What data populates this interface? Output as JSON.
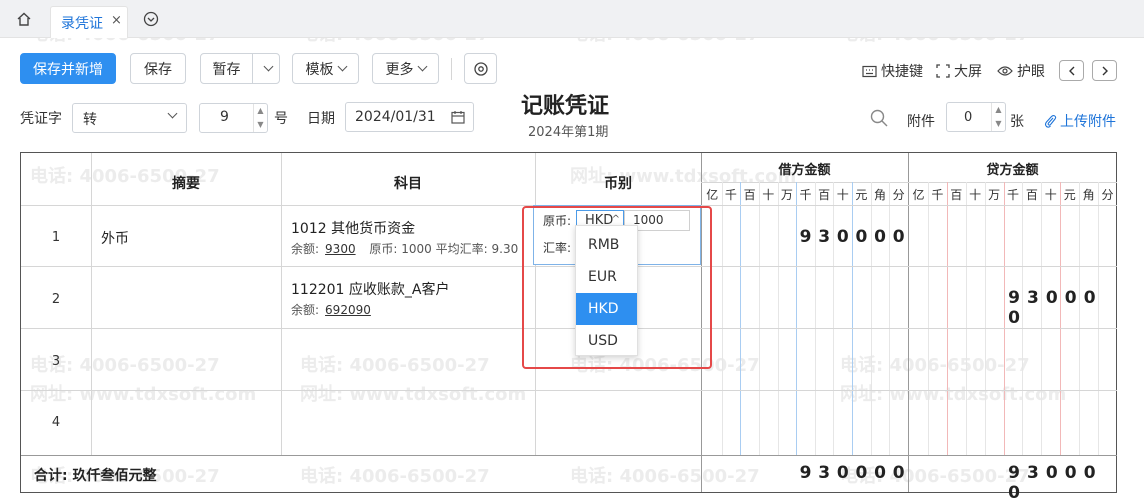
{
  "watermark": {
    "phone": "电话: 4006-6500-27",
    "site": "网址: www.tdxsoft.com"
  },
  "tabs": [
    {
      "label": "录凭证",
      "close": "×"
    }
  ],
  "toolbar": {
    "save_and_new": "保存并新增",
    "save": "保存",
    "draft": "暂存",
    "template": "模板",
    "more": "更多",
    "shortcut": "快捷键",
    "fullscreen": "大屏",
    "eye_care": "护眼"
  },
  "header": {
    "voucher_word_label": "凭证字",
    "voucher_word_value": "转",
    "number_value": "9",
    "number_suffix": "号",
    "date_label": "日期",
    "date_value": "2024/01/31",
    "title": "记账凭证",
    "period": "2024年第1期",
    "attachment_label": "附件",
    "attachment_value": "0",
    "attachment_suffix": "张",
    "upload_label": "上传附件"
  },
  "table": {
    "headers": {
      "summary": "摘要",
      "account": "科目",
      "currency": "币别",
      "debit": "借方金额",
      "credit": "贷方金额"
    },
    "digit_units": [
      "亿",
      "千",
      "百",
      "十",
      "万",
      "千",
      "百",
      "十",
      "元",
      "角",
      "分"
    ],
    "rows": [
      {
        "num": "1",
        "summary": "外币",
        "account": "1012 其他货币资金",
        "balance_label": "余额:",
        "balance": "9300",
        "extra": "原币: 1000 平均汇率: 9.30",
        "debit_digits": [
          "9",
          "3",
          "0",
          "0",
          "0",
          "0"
        ],
        "credit_digits": []
      },
      {
        "num": "2",
        "summary": "",
        "account": "112201 应收账款_A客户",
        "balance_label": "余额:",
        "balance": "692090",
        "extra": "",
        "debit_digits": [],
        "credit_digits": [
          "9",
          "3",
          "0",
          "0",
          "0",
          "0"
        ]
      },
      {
        "num": "3",
        "summary": "",
        "account": "",
        "balance_label": "",
        "balance": "",
        "extra": "",
        "debit_digits": [],
        "credit_digits": []
      },
      {
        "num": "4",
        "summary": "",
        "account": "",
        "balance_label": "",
        "balance": "",
        "extra": "",
        "debit_digits": [],
        "credit_digits": []
      }
    ],
    "total_label": "合计: 玖仟叁佰元整",
    "total_debit_digits": [
      "9",
      "3",
      "0",
      "0",
      "0",
      "0"
    ],
    "total_credit_digits": [
      "9",
      "3",
      "0",
      "0",
      "0",
      "0"
    ]
  },
  "currency_editor": {
    "original_label": "原币:",
    "selected": "HKD",
    "amount": "1000",
    "rate_label": "汇率:",
    "options": [
      "RMB",
      "EUR",
      "HKD",
      "USD"
    ]
  },
  "colors": {
    "primary": "#2e8ff0",
    "highlight": "#e54848",
    "debit_grid_blue": "#a9cdf2",
    "credit_grid_red": "#f2b8b8"
  }
}
